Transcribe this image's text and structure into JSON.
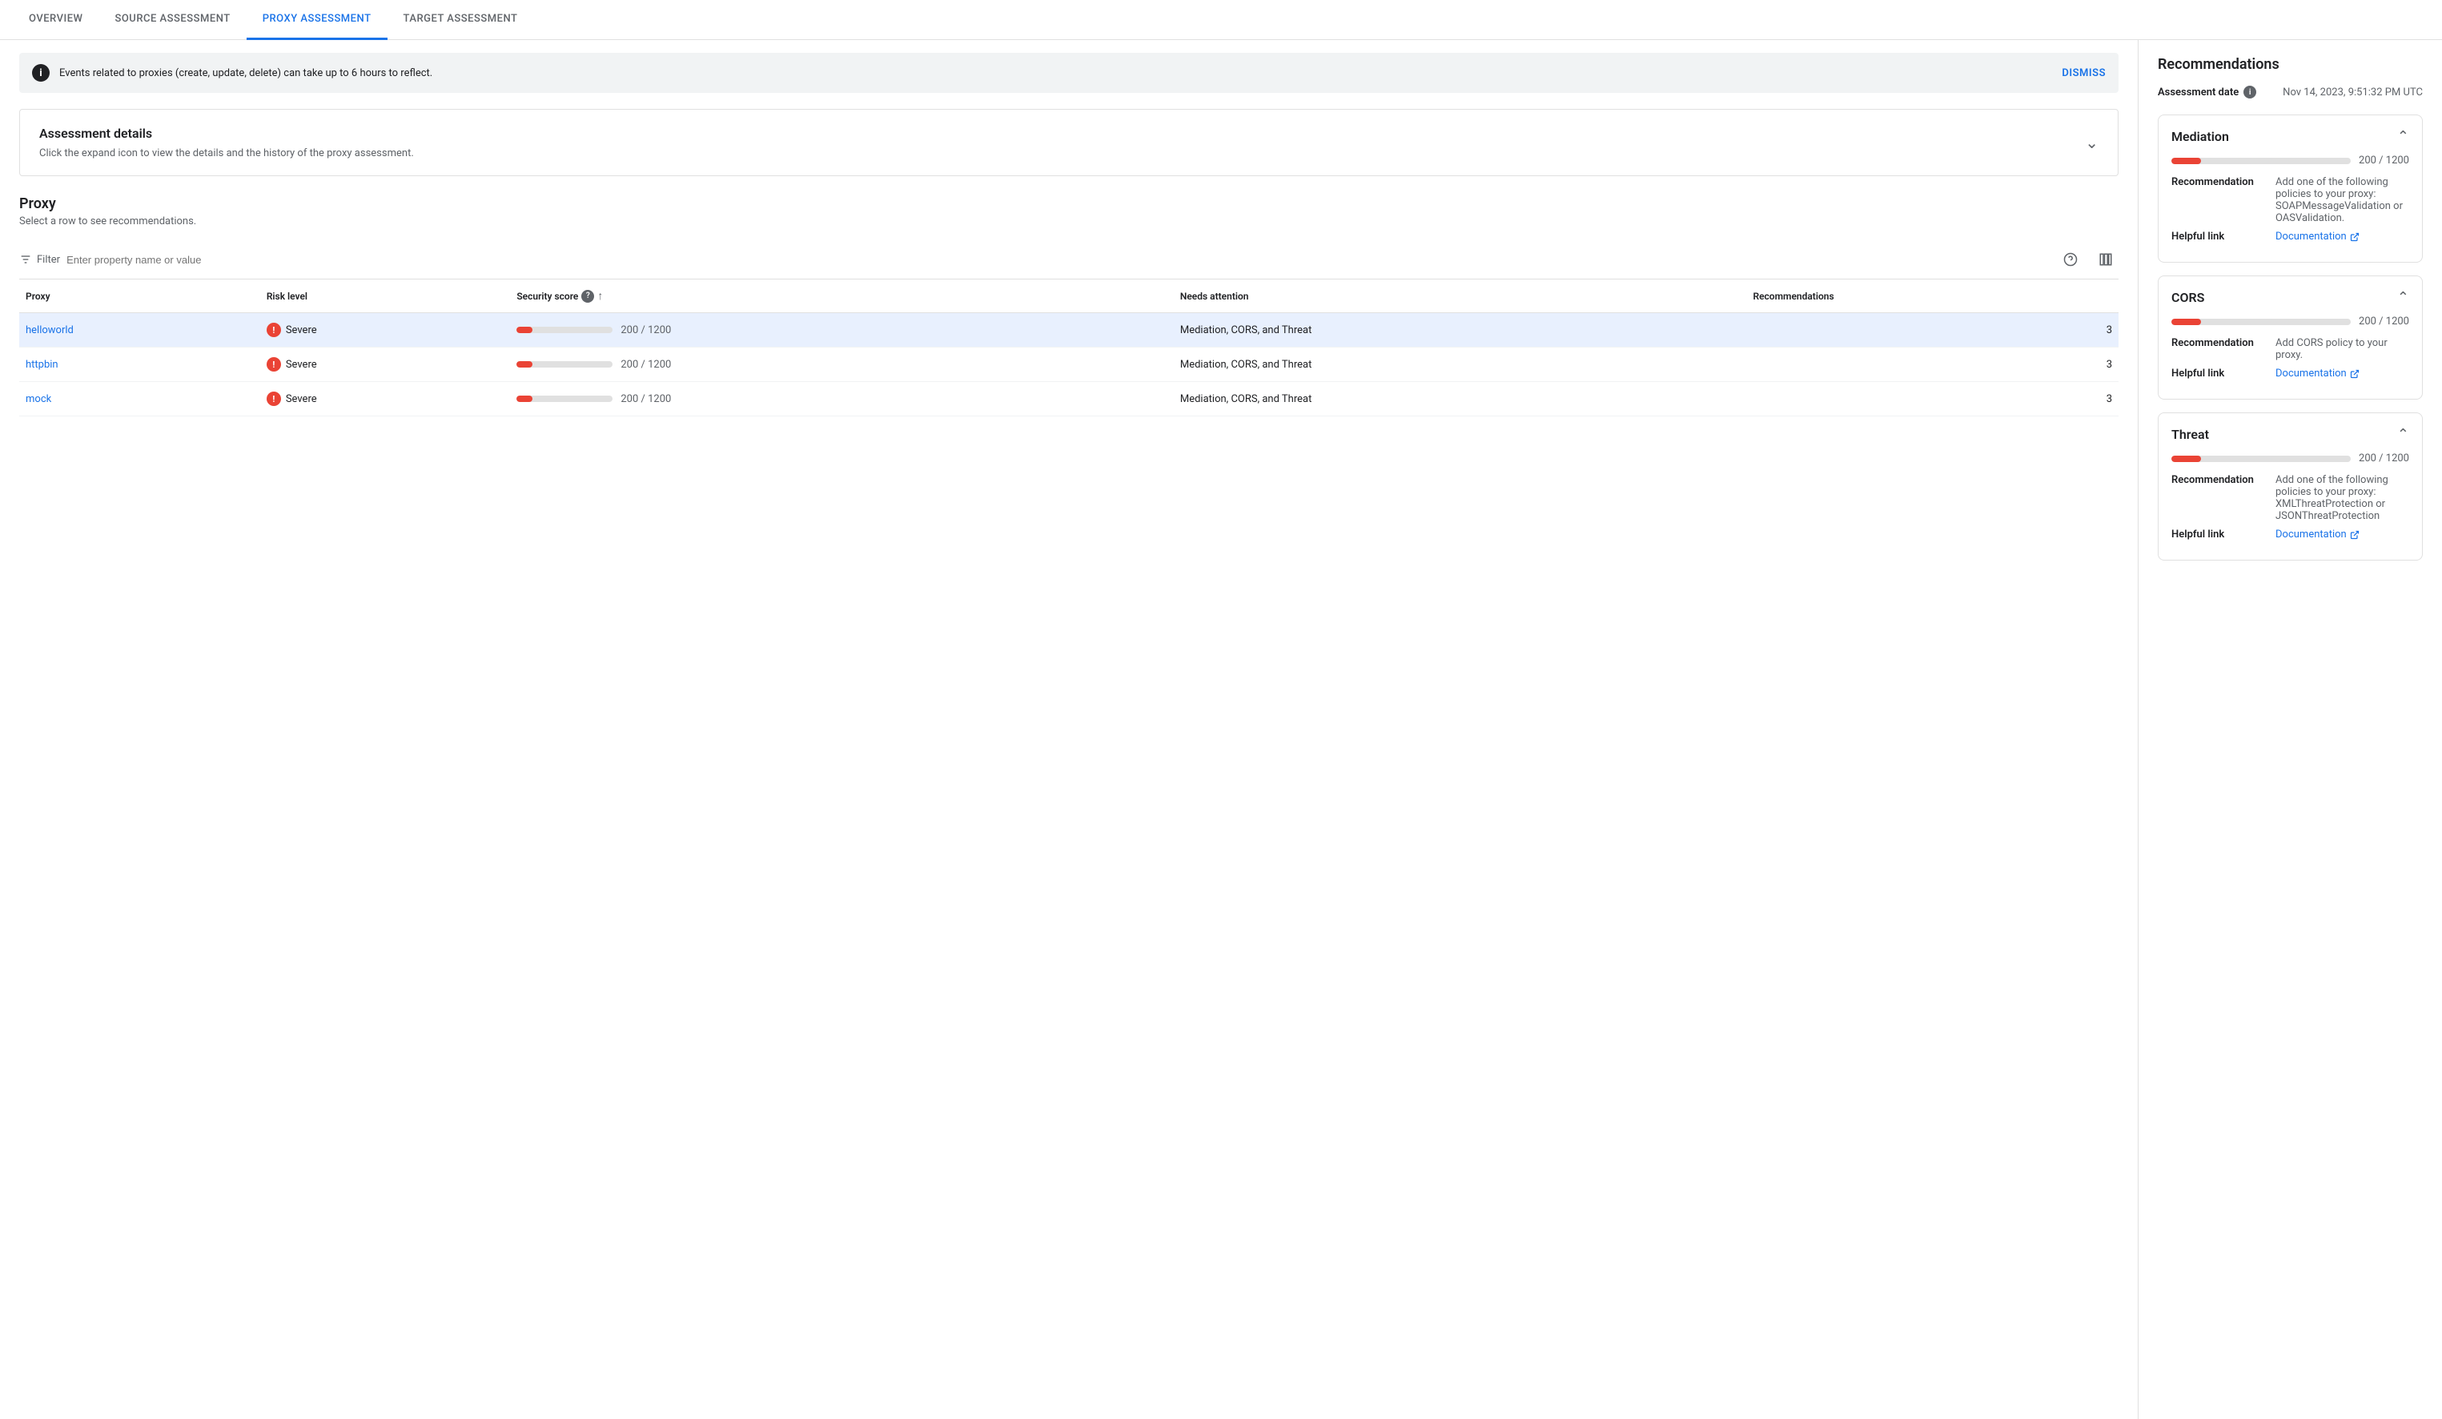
{
  "nav": {
    "tabs": [
      {
        "label": "OVERVIEW",
        "active": false
      },
      {
        "label": "SOURCE ASSESSMENT",
        "active": false
      },
      {
        "label": "PROXY ASSESSMENT",
        "active": true
      },
      {
        "label": "TARGET ASSESSMENT",
        "active": false
      }
    ]
  },
  "banner": {
    "text": "Events related to proxies (create, update, delete) can take up to 6 hours to reflect.",
    "dismiss_label": "DISMISS"
  },
  "assessment_details": {
    "title": "Assessment details",
    "description": "Click the expand icon to view the details and the history of the proxy assessment."
  },
  "proxy_section": {
    "title": "Proxy",
    "subtitle": "Select a row to see recommendations.",
    "filter_placeholder": "Enter property name or value"
  },
  "table": {
    "columns": [
      {
        "label": "Proxy"
      },
      {
        "label": "Risk level"
      },
      {
        "label": "Security score",
        "has_help": true,
        "has_sort": true
      },
      {
        "label": "Needs attention"
      },
      {
        "label": "Recommendations"
      }
    ],
    "rows": [
      {
        "proxy": "helloworld",
        "risk_level": "Severe",
        "score_value": "200 / 1200",
        "score_pct": "16.7",
        "needs_attention": "Mediation, CORS, and Threat",
        "recommendations": "3",
        "selected": true
      },
      {
        "proxy": "httpbin",
        "risk_level": "Severe",
        "score_value": "200 / 1200",
        "score_pct": "16.7",
        "needs_attention": "Mediation, CORS, and Threat",
        "recommendations": "3",
        "selected": false
      },
      {
        "proxy": "mock",
        "risk_level": "Severe",
        "score_value": "200 / 1200",
        "score_pct": "16.7",
        "needs_attention": "Mediation, CORS, and Threat",
        "recommendations": "3",
        "selected": false
      }
    ]
  },
  "right_panel": {
    "title": "Recommendations",
    "assessment_date_label": "Assessment date",
    "assessment_date_value": "Nov 14, 2023, 9:51:32 PM UTC",
    "cards": [
      {
        "title": "Mediation",
        "score_value": "200 / 1200",
        "score_pct": "16.7",
        "recommendation_label": "Recommendation",
        "recommendation_value": "Add one of the following policies to your proxy: SOAPMessageValidation or OASValidation.",
        "helpful_link_label": "Helpful link",
        "helpful_link_text": "Documentation",
        "collapsed": false
      },
      {
        "title": "CORS",
        "score_value": "200 / 1200",
        "score_pct": "16.7",
        "recommendation_label": "Recommendation",
        "recommendation_value": "Add CORS policy to your proxy.",
        "helpful_link_label": "Helpful link",
        "helpful_link_text": "Documentation",
        "collapsed": false
      },
      {
        "title": "Threat",
        "score_value": "200 / 1200",
        "score_pct": "16.7",
        "recommendation_label": "Recommendation",
        "recommendation_value": "Add one of the following policies to your proxy: XMLThreatProtection or JSONThreatProtection",
        "helpful_link_label": "Helpful link",
        "helpful_link_text": "Documentation",
        "collapsed": false
      }
    ]
  }
}
